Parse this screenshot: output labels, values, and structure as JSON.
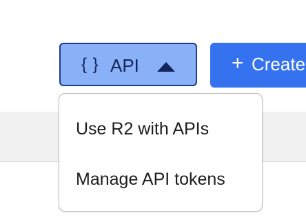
{
  "toolbar": {
    "api_button": {
      "braces": "{ }",
      "label": "API",
      "caret_icon": "caret-up-icon"
    },
    "create_button": {
      "plus": "+",
      "label": "Create"
    }
  },
  "dropdown": {
    "items": [
      {
        "label": "Use R2 with APIs"
      },
      {
        "label": "Manage API tokens"
      }
    ]
  },
  "colors": {
    "api_button_bg": "#8ab0f7",
    "api_button_border": "#1f3a8a",
    "create_button_bg": "#3572ef",
    "band_bg": "#f1f1f1"
  }
}
